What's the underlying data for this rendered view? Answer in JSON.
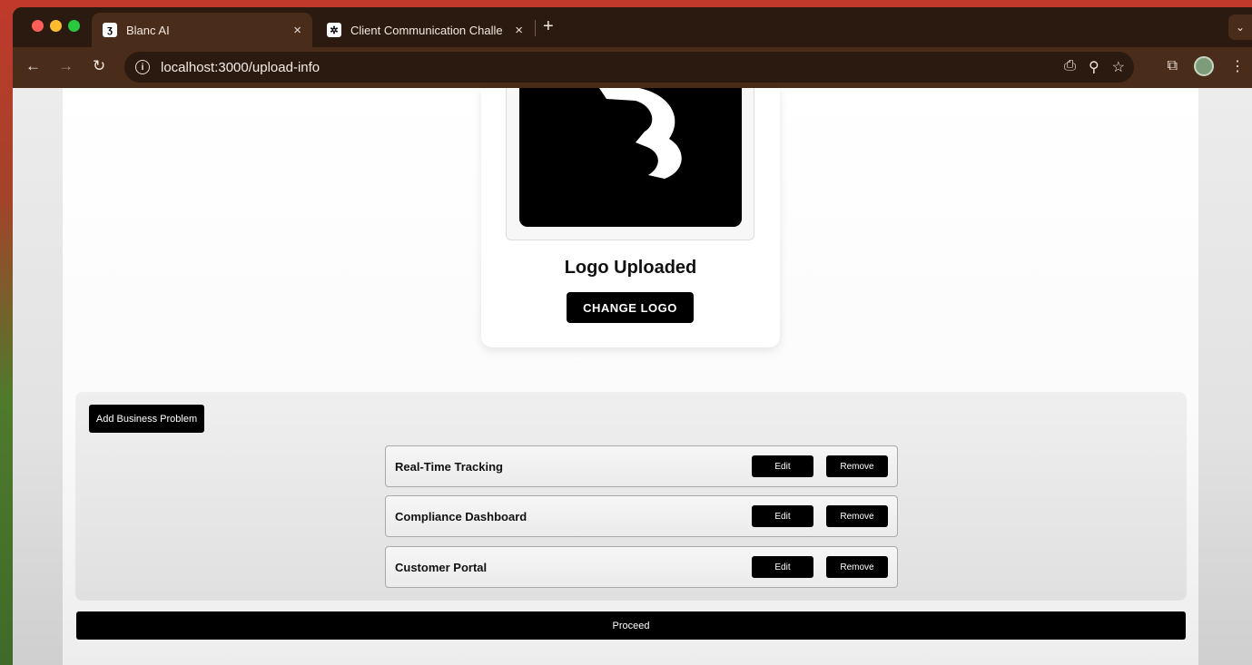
{
  "browser": {
    "tabs": [
      {
        "title": "Blanc AI",
        "favicon": "blanc-logo-icon",
        "active": true
      },
      {
        "title": "Client Communication Challe",
        "favicon": "openai-icon",
        "active": false
      }
    ],
    "address": "localhost:3000/upload-info",
    "new_tab_symbol": "+",
    "close_symbol": "×"
  },
  "logo_section": {
    "title": "Logo Uploaded",
    "change_label": "CHANGE LOGO"
  },
  "problems": {
    "add_label": "Add Business Problem",
    "items": [
      {
        "name": "Real-Time Tracking",
        "edit": "Edit",
        "remove": "Remove"
      },
      {
        "name": "Compliance Dashboard",
        "edit": "Edit",
        "remove": "Remove"
      },
      {
        "name": "Customer Portal",
        "edit": "Edit",
        "remove": "Remove"
      }
    ]
  },
  "proceed_label": "Proceed",
  "colors": {
    "tab_bar": "#2b1a10",
    "toolbar": "#4a2c1a",
    "button": "#000000"
  }
}
